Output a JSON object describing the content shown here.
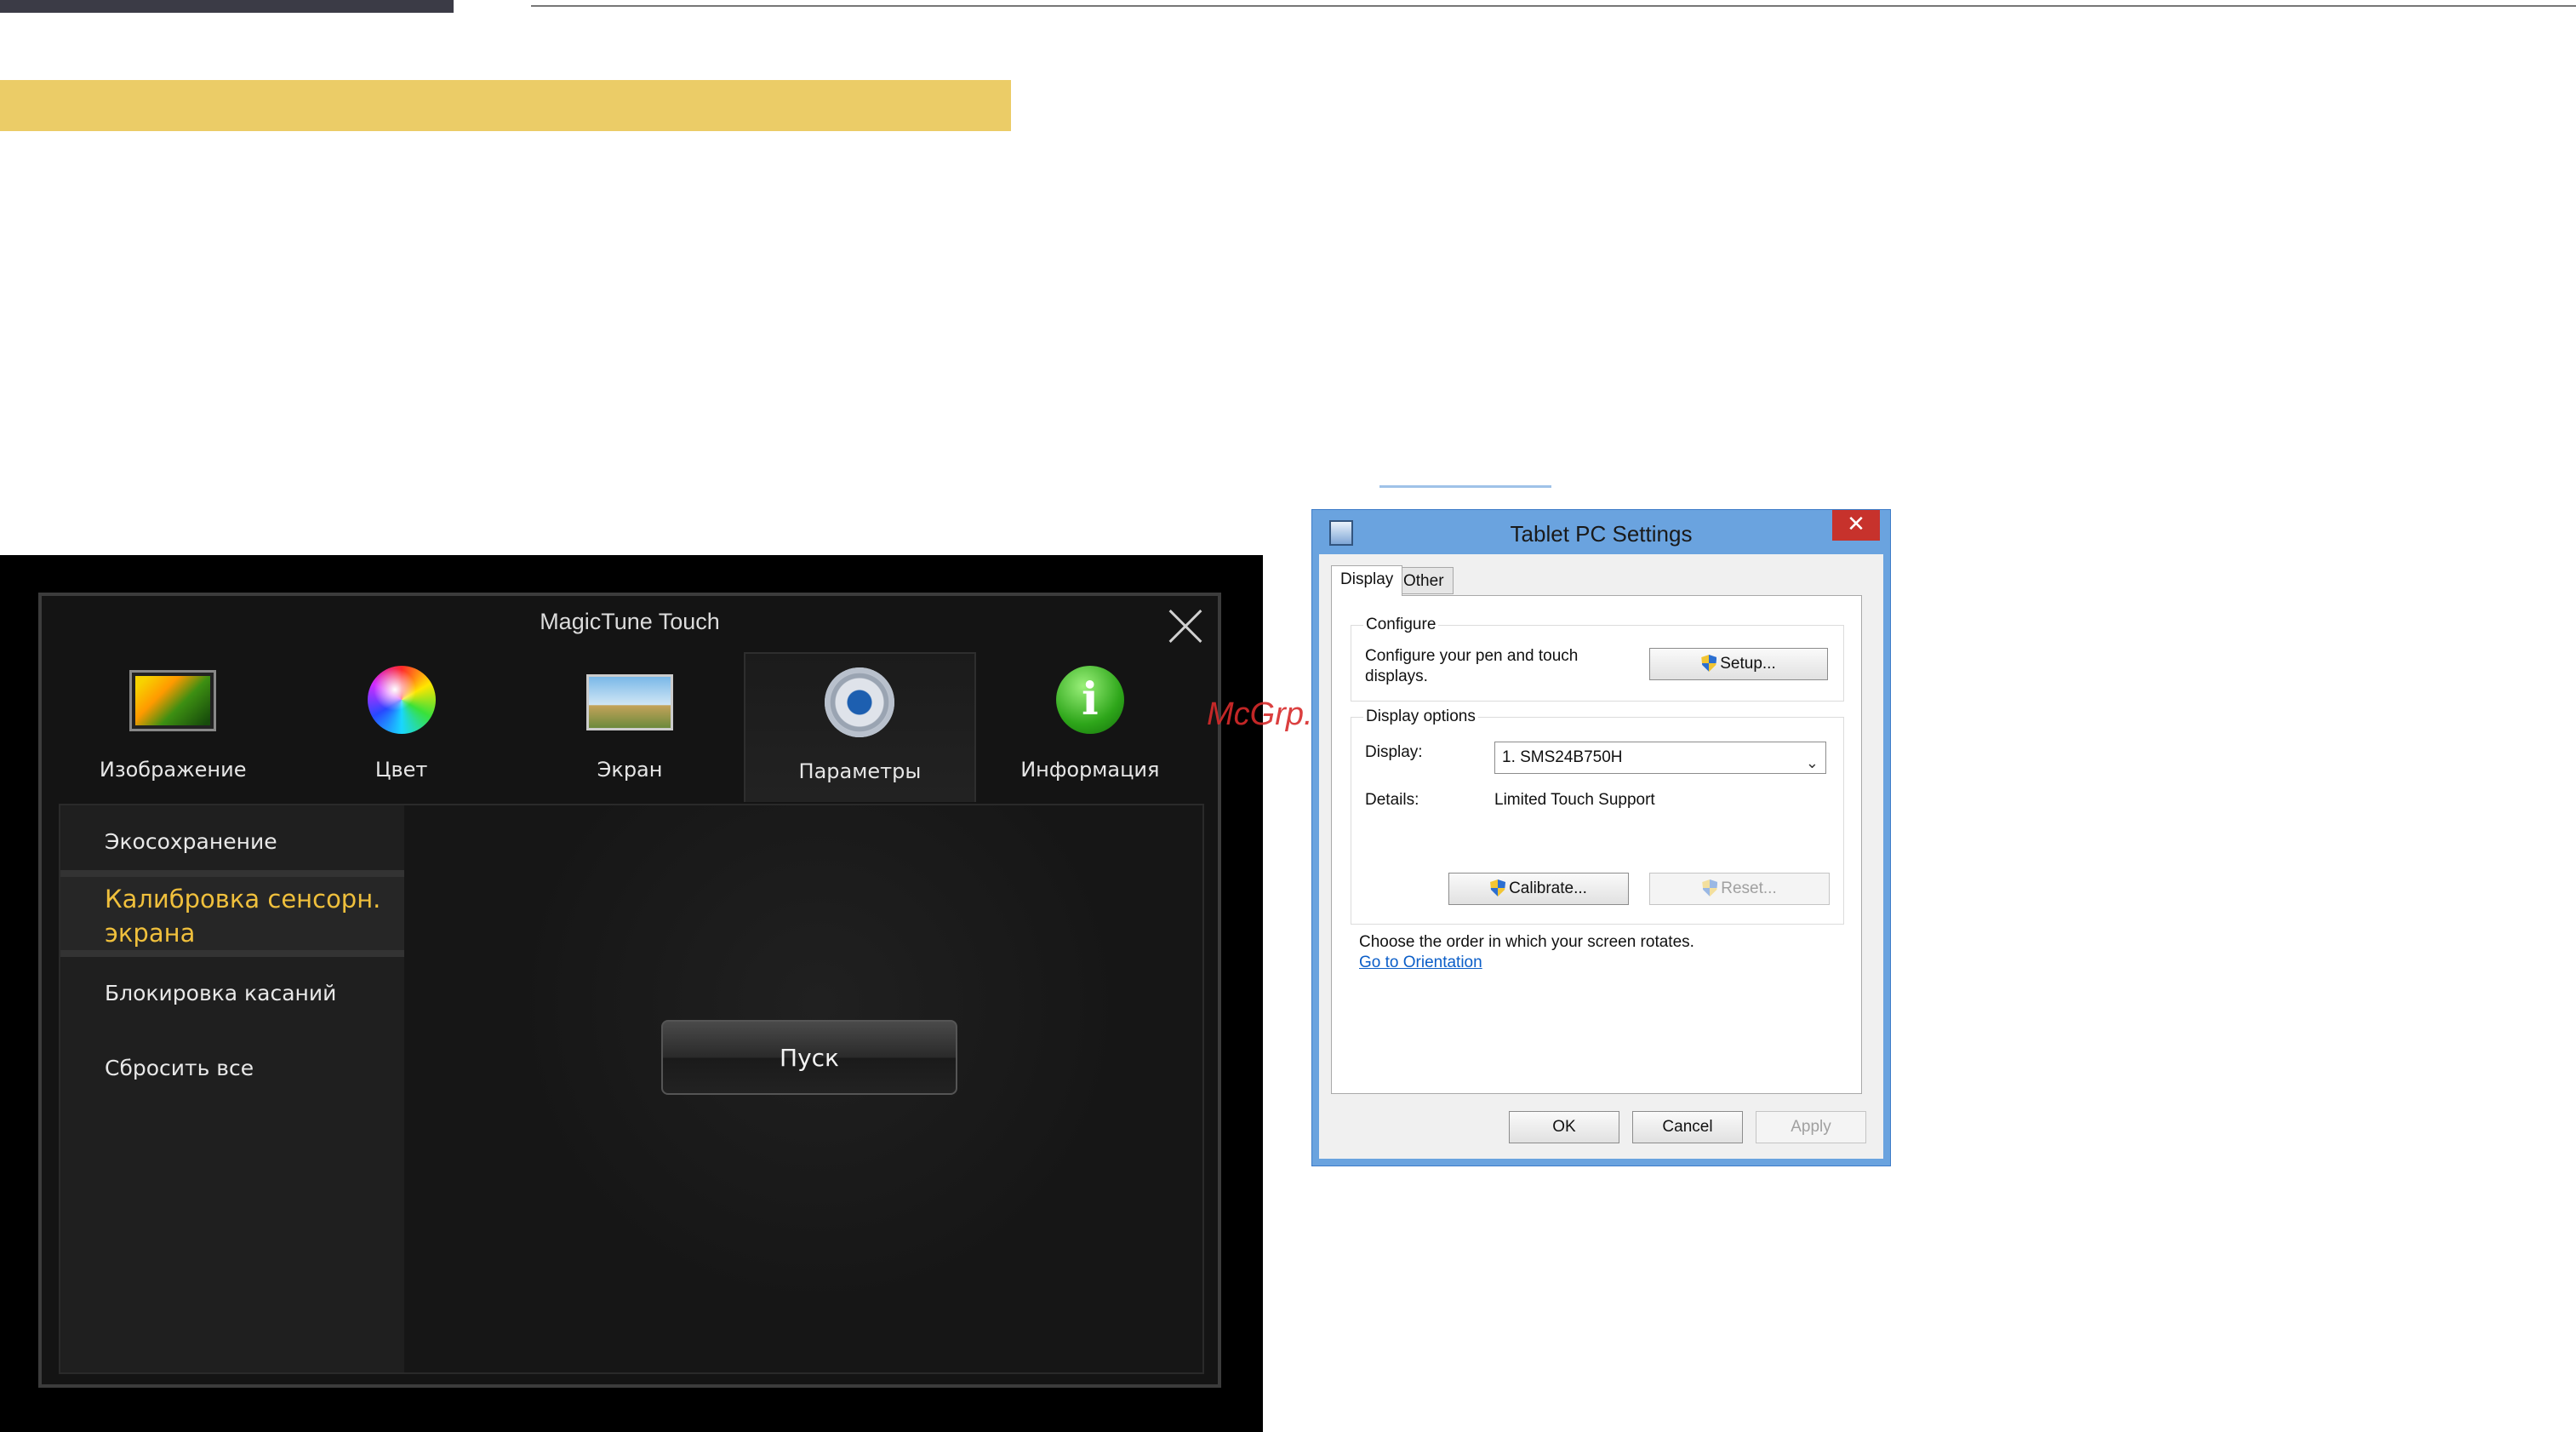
{
  "magictune": {
    "title": "MagicTune Touch",
    "tabs": [
      {
        "label": "Изображение",
        "icon": "picture-monitor-icon"
      },
      {
        "label": "Цвет",
        "icon": "color-wheel-icon"
      },
      {
        "label": "Экран",
        "icon": "screen-resize-icon"
      },
      {
        "label": "Параметры",
        "icon": "gear-icon"
      },
      {
        "label": "Информация",
        "icon": "info-icon"
      }
    ],
    "active_tab": "Параметры",
    "sidebar": [
      {
        "label": "Экосохранение"
      },
      {
        "label": "Калибровка сенсорн. экрана"
      },
      {
        "label": "Блокировка касаний"
      },
      {
        "label": "Сбросить все"
      }
    ],
    "selected_item": "Калибровка сенсорн. экрана",
    "start_button": "Пуск",
    "accent_color": "#f0c03c"
  },
  "watermark": "McGrp.Ru",
  "tablet_settings": {
    "title": "Tablet PC Settings",
    "close_glyph": "✕",
    "tabs": [
      "Display",
      "Other"
    ],
    "configure": {
      "legend": "Configure",
      "text": "Configure your pen and touch displays.",
      "setup_button": "Setup..."
    },
    "display_options": {
      "legend": "Display options",
      "display_label": "Display:",
      "display_value": "1. SMS24B750H",
      "details_label": "Details:",
      "details_value": "Limited Touch Support",
      "calibrate_button": "Calibrate...",
      "reset_button": "Reset..."
    },
    "orientation_text": "Choose the order in which your screen rotates.",
    "orientation_link": "Go to Orientation",
    "buttons": {
      "ok": "OK",
      "cancel": "Cancel",
      "apply": "Apply"
    }
  }
}
